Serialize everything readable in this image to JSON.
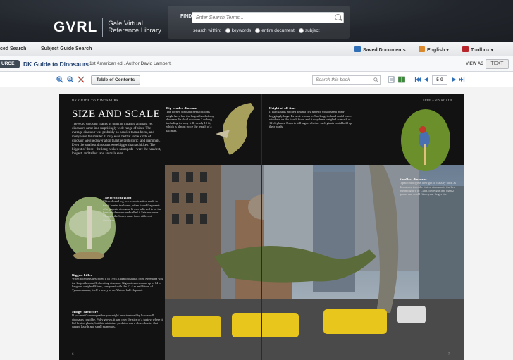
{
  "header": {
    "logo": "GVRL",
    "logo_sub_line1": "Gale Virtual",
    "logo_sub_line2": "Reference Library",
    "find_label": "FIND:",
    "search_placeholder": "Enter Search Terms...",
    "search_within_label": "search within:",
    "search_options": [
      "keywords",
      "entire document",
      "subject"
    ]
  },
  "nav": {
    "advanced_search": "ced Search",
    "subject_guide_search": "Subject Guide Search",
    "saved_documents": "Saved Documents",
    "language": "English",
    "toolbox": "Toolbox"
  },
  "title_bar": {
    "source_tab": "URCE",
    "book_title": "DK Guide to Dinosaurs",
    "book_meta": "1st American ed.. Author David Lambert.",
    "view_as_label": "VIEW AS",
    "view_as_option": "TEXT"
  },
  "toolbar": {
    "toc_button": "Table of Contents",
    "search_book_placeholder": "Search this book",
    "page_range": "5-9"
  },
  "spread": {
    "left_running_head": "DK GUIDE TO DINOSAURS",
    "right_running_head": "SIZE AND SCALE",
    "page_title": "SIZE AND SCALE",
    "intro_text": "The word dinosaur makes us think of gigantic animals, yet dinosaurs came in a surprisingly wide range of sizes. The average dinosaur was probably no heavier than a horse, and many were far smaller. It may even be that some kinds of dinosaur weighed over a ton than the prehistoric land mammals. Even the smallest dinosaurs were bigger than a chicken. The biggest of these - the long-necked sauropods - were the heaviest, longest, and tallest land animals ever.",
    "mythical_giant_heading": "The mythical giant",
    "mythical_giant_text": "This colossal leg is a reconstruction made to fossil hunter the bones, often found fragments of a gigantic dinosaur. It was believed to be the heaviest dinosaur and called it Seismosaurus. Thought the bones came from different dinosaurs.",
    "biggest_killer_heading": "Biggest killer",
    "biggest_killer_text": "When scientists described it in 1995, Giganotosaurus from Argentina was the largest known flesh-eating dinosaur. Giganotosaurus was up to 14 m long and weighed 8 tons, compared with the 12.4 m and 6 tons of Tyrannosaurus, itself a heavy as an African bull elephant.",
    "midget_heading": "Midget carnivore",
    "midget_text": "If you met Compsognathus you might be astonished by how small dinosaurs could be. Fully grown, it was only the size of a turkey, where it hid behind plants, but this miniature predator was a clever hunter that caught lizards and small mammals.",
    "big_headed_heading": "Big-headed dinosaur",
    "big_headed_text": "The horned dinosaur Pentaceratops might have had the largest head of any dinosaur. Its skull was over 3 m long including its bony frill, nearly 10 ft, which is almost twice the length of a tall man.",
    "height_heading": "Height of all time",
    "height_text": "If Barosaurus strolled down a city street it would seem mind-bogglingly huge. Its neck was up to 9 m long, its head could reach windows on the fourth floor, and it may have weighed as much as 12 elephants. Experts still argue whether such giants could hold up their heads.",
    "smallest_heading": "Smallest dinosaur",
    "smallest_text": "If paleontologists are right to classify birds as dinosaurs, then the tiniest dinosaur is the bee hummingbird of Cuba. It weighs less than 2 grams and could fit on your finger tip.",
    "page_left": "6",
    "page_right": "7"
  }
}
